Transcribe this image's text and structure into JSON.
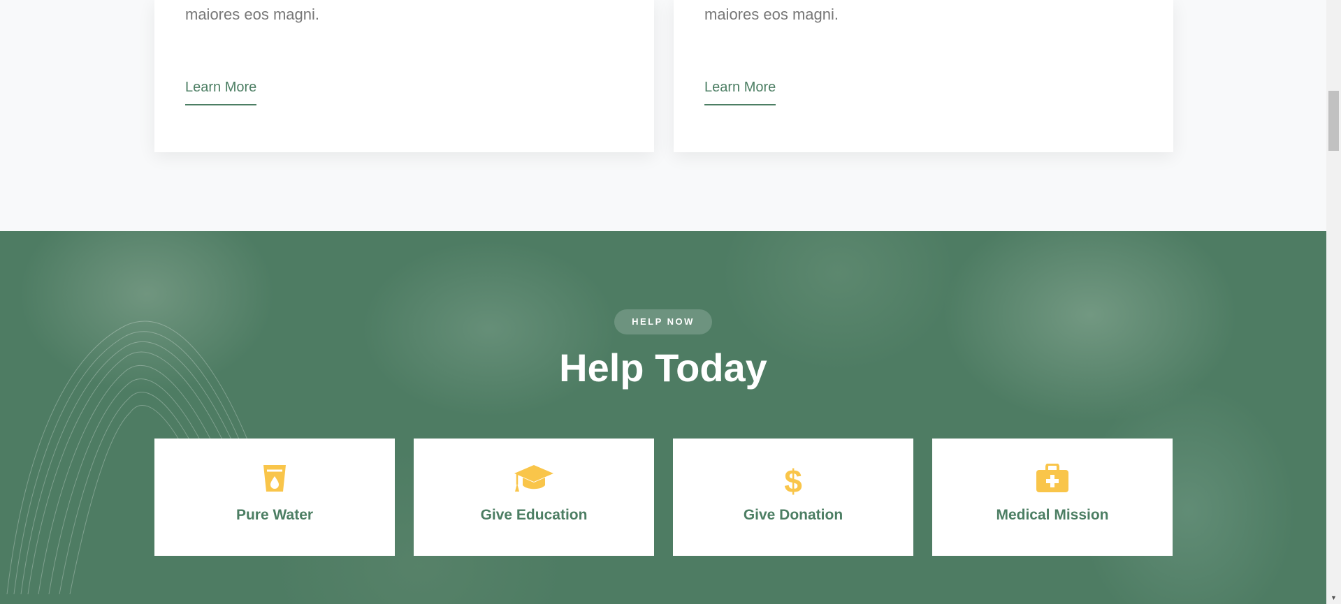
{
  "cards": [
    {
      "text": "minima dignissimos hic mollitia eius et quam ducimus\nmaiores eos magni.",
      "link": "Learn More"
    },
    {
      "text": "minima dignissimos hic mollitia eius et quam ducimus\nmaiores eos magni.",
      "link": "Learn More"
    }
  ],
  "help": {
    "badge": "HELP NOW",
    "title": "Help Today",
    "items": [
      {
        "label": "Pure Water",
        "icon": "glass-water-icon"
      },
      {
        "label": "Give Education",
        "icon": "graduation-cap-icon"
      },
      {
        "label": "Give Donation",
        "icon": "dollar-icon"
      },
      {
        "label": "Medical Mission",
        "icon": "medical-kit-icon"
      }
    ]
  },
  "colors": {
    "accent": "#4c7e63",
    "icon": "#f9c54a",
    "hero": "#4e7c63",
    "text": "#777777"
  }
}
